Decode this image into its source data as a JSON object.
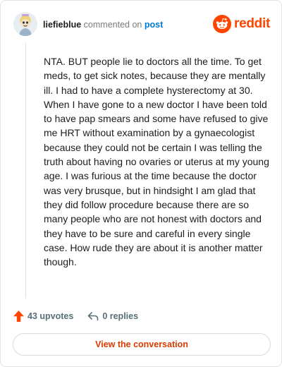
{
  "header": {
    "username": "liefieblue",
    "action_text": "commented on",
    "post_link": "post",
    "brand": "reddit",
    "brand_color": "#ff4500"
  },
  "comment": {
    "body": "NTA. BUT people lie to doctors all the time. To get meds, to get sick notes, because they are mentally ill. I had to have a complete hysterectomy at 30. When I have gone to a new doctor I have been told to have pap smears and some have refused to give me HRT without examination by a gynaecologist because they could not be certain I was telling the truth about having no ovaries or uterus at my young age. I was furious at the time because the doctor was very brusque, but in hindsight I am glad that they did follow procedure because there are so many people who are not honest with doctors and they have to be sure and careful in every single case. How rude they are about it is another matter though."
  },
  "actions": {
    "upvotes": "43 upvotes",
    "replies": "0 replies",
    "upvote_icon": "upvote-arrow-icon",
    "reply_icon": "reply-icon"
  },
  "footer": {
    "view_conversation_label": "View the conversation",
    "accent_color": "#d93a00"
  }
}
